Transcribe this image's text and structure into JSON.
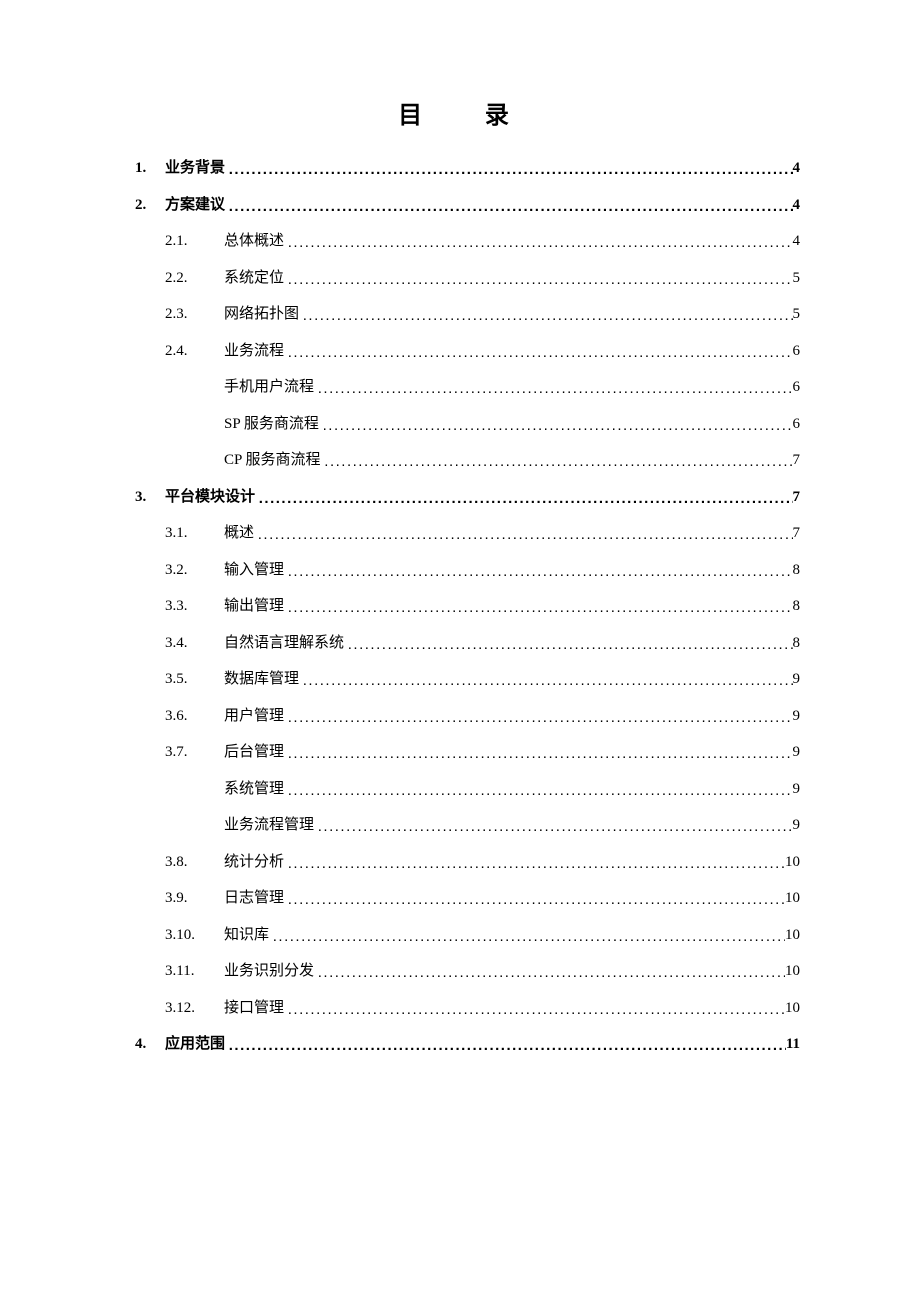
{
  "title": "目 录",
  "toc": [
    {
      "level": 1,
      "bold": true,
      "num": "1.",
      "label": "业务背景",
      "page": "4"
    },
    {
      "level": 1,
      "bold": true,
      "num": "2.",
      "label": "方案建议",
      "page": "4"
    },
    {
      "level": 2,
      "bold": false,
      "num": "2.1.",
      "label": "总体概述",
      "page": "4"
    },
    {
      "level": 2,
      "bold": false,
      "num": "2.2.",
      "label": "系统定位",
      "page": "5"
    },
    {
      "level": 2,
      "bold": false,
      "num": "2.3.",
      "label": "网络拓扑图",
      "page": "5"
    },
    {
      "level": 2,
      "bold": false,
      "num": "2.4.",
      "label": "业务流程",
      "page": "6"
    },
    {
      "level": 3,
      "bold": false,
      "num": "",
      "label": "手机用户流程",
      "page": "6"
    },
    {
      "level": 3,
      "bold": false,
      "num": "",
      "label": "SP 服务商流程",
      "page": "6"
    },
    {
      "level": 3,
      "bold": false,
      "num": "",
      "label": "CP 服务商流程",
      "page": "7"
    },
    {
      "level": 1,
      "bold": true,
      "num": "3.",
      "label": "平台模块设计",
      "page": "7"
    },
    {
      "level": 2,
      "bold": false,
      "num": "3.1.",
      "label": "概述",
      "page": "7"
    },
    {
      "level": 2,
      "bold": false,
      "num": "3.2.",
      "label": "输入管理",
      "page": "8"
    },
    {
      "level": 2,
      "bold": false,
      "num": "3.3.",
      "label": "输出管理",
      "page": "8"
    },
    {
      "level": 2,
      "bold": false,
      "num": "3.4.",
      "label": "自然语言理解系统",
      "page": "8"
    },
    {
      "level": 2,
      "bold": false,
      "num": "3.5.",
      "label": "数据库管理",
      "page": "9"
    },
    {
      "level": 2,
      "bold": false,
      "num": "3.6.",
      "label": "用户管理",
      "page": "9"
    },
    {
      "level": 2,
      "bold": false,
      "num": "3.7.",
      "label": "后台管理",
      "page": "9"
    },
    {
      "level": 3,
      "bold": false,
      "num": "",
      "label": "系统管理",
      "page": "9"
    },
    {
      "level": 3,
      "bold": false,
      "num": "",
      "label": "业务流程管理",
      "page": "9"
    },
    {
      "level": 2,
      "bold": false,
      "num": "3.8.",
      "label": "统计分析",
      "page": "10"
    },
    {
      "level": 2,
      "bold": false,
      "num": "3.9.",
      "label": "日志管理",
      "page": "10"
    },
    {
      "level": 2,
      "bold": false,
      "num": "3.10.",
      "label": "知识库",
      "page": "10"
    },
    {
      "level": 2,
      "bold": false,
      "num": "3.11.",
      "label": "业务识别分发",
      "page": "10"
    },
    {
      "level": 2,
      "bold": false,
      "num": "3.12.",
      "label": "接口管理",
      "page": "10"
    },
    {
      "level": 1,
      "bold": true,
      "num": "4.",
      "label": "应用范围",
      "page": "11"
    }
  ]
}
